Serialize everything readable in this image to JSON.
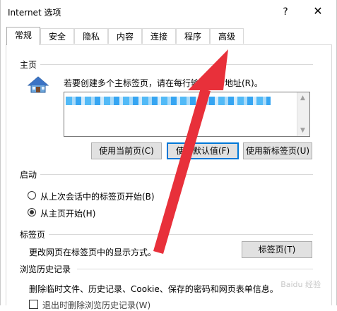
{
  "window": {
    "title": "Internet 选项",
    "help": "?",
    "close": "✕"
  },
  "tabs": [
    {
      "label": "常规",
      "active": true
    },
    {
      "label": "安全",
      "active": false
    },
    {
      "label": "隐私",
      "active": false
    },
    {
      "label": "内容",
      "active": false
    },
    {
      "label": "连接",
      "active": false
    },
    {
      "label": "程序",
      "active": false
    },
    {
      "label": "高级",
      "active": false
    }
  ],
  "homepage": {
    "title": "主页",
    "desc": "若要创建多个主标签页，请在每行输入一个地址(R)。",
    "url_value": "",
    "buttons": {
      "use_current": "使用当前页(C)",
      "use_default": "使用默认值(F)",
      "use_new_tab": "使用新标签页(U)"
    }
  },
  "startup": {
    "title": "启动",
    "options": [
      {
        "label": "从上次会话中的标签页开始(B)",
        "selected": false
      },
      {
        "label": "从主页开始(H)",
        "selected": true
      }
    ]
  },
  "tabs_section": {
    "title": "标签页",
    "desc": "更改网页在标签页中的显示方式。",
    "button": "标签页(T)"
  },
  "history": {
    "title": "浏览历史记录",
    "desc": "删除临时文件、历史记录、Cookie、保存的密码和网页表单信息。",
    "cut_checkbox": "退出时删除浏览历史记录(W)"
  },
  "icons": {
    "homepage": "house-icon",
    "annotation": "red-arrow-icon"
  },
  "colors": {
    "arrow": "#e8303a",
    "accent": "#0078d7"
  },
  "watermark": "Baidu 经验"
}
